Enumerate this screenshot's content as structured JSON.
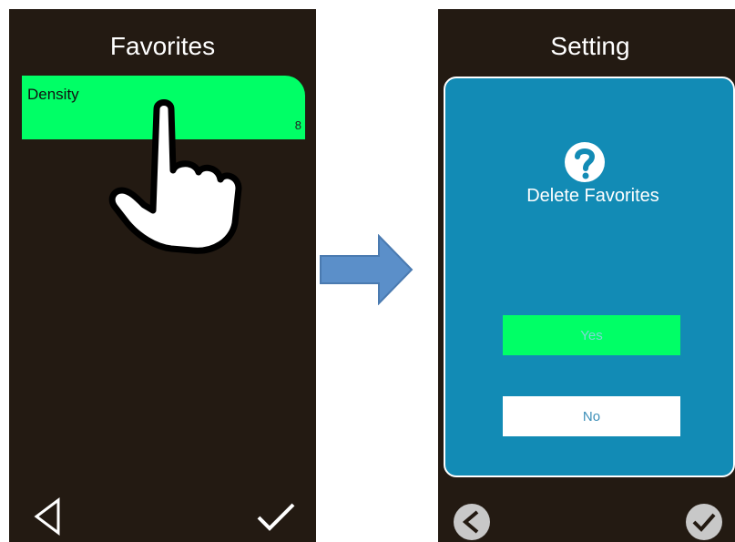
{
  "left_screen": {
    "title": "Favorites",
    "items": [
      {
        "label": "Density",
        "value": "8"
      }
    ],
    "icons": {
      "gesture": "tap-hand-icon",
      "back": "back-triangle-icon",
      "confirm": "checkmark-icon"
    }
  },
  "flow": {
    "arrow_icon": "right-arrow-icon",
    "arrow_color": "#5b8fc9"
  },
  "right_screen": {
    "title": "Setting",
    "dialog": {
      "icon": "question-mark-icon",
      "message": "Delete Favorites",
      "yes_label": "Yes",
      "no_label": "No"
    },
    "icons": {
      "back": "back-circle-icon",
      "confirm": "check-circle-icon"
    }
  },
  "colors": {
    "screen_background": "#231a12",
    "highlight_green": "#00ff66",
    "dialog_blue": "#128bb5",
    "text_white": "#ffffff"
  }
}
